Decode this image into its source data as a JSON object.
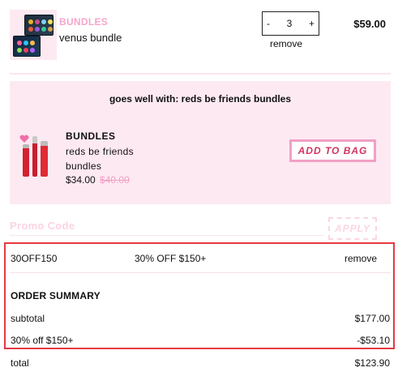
{
  "cart_item": {
    "brand": "BUNDLES",
    "name": "venus bundle",
    "qty_minus": "-",
    "quantity": "3",
    "qty_plus": "+",
    "remove": "remove",
    "price": "$59.00"
  },
  "recommendation": {
    "heading": "goes well with: reds be friends bundles",
    "brand": "BUNDLES",
    "name": "reds be friends bundles",
    "price": "$34.00",
    "old_price": "$40.00",
    "add_button": "ADD TO BAG"
  },
  "promo": {
    "label": "Promo Code",
    "apply_button": "APPLY",
    "applied_code": "30OFF150",
    "applied_description": "30% OFF $150+",
    "remove": "remove"
  },
  "summary": {
    "title": "ORDER SUMMARY",
    "subtotal_label": "subtotal",
    "subtotal_value": "$177.00",
    "discount_label": "30% off $150+",
    "discount_value": "-$53.10",
    "total_label": "total",
    "total_value": "$123.90"
  },
  "colors": {
    "brand_pink": "#f5a6cb",
    "panel_pink": "#fde9f2",
    "button_text_red": "#d2335f",
    "highlight_red": "#e53941"
  }
}
